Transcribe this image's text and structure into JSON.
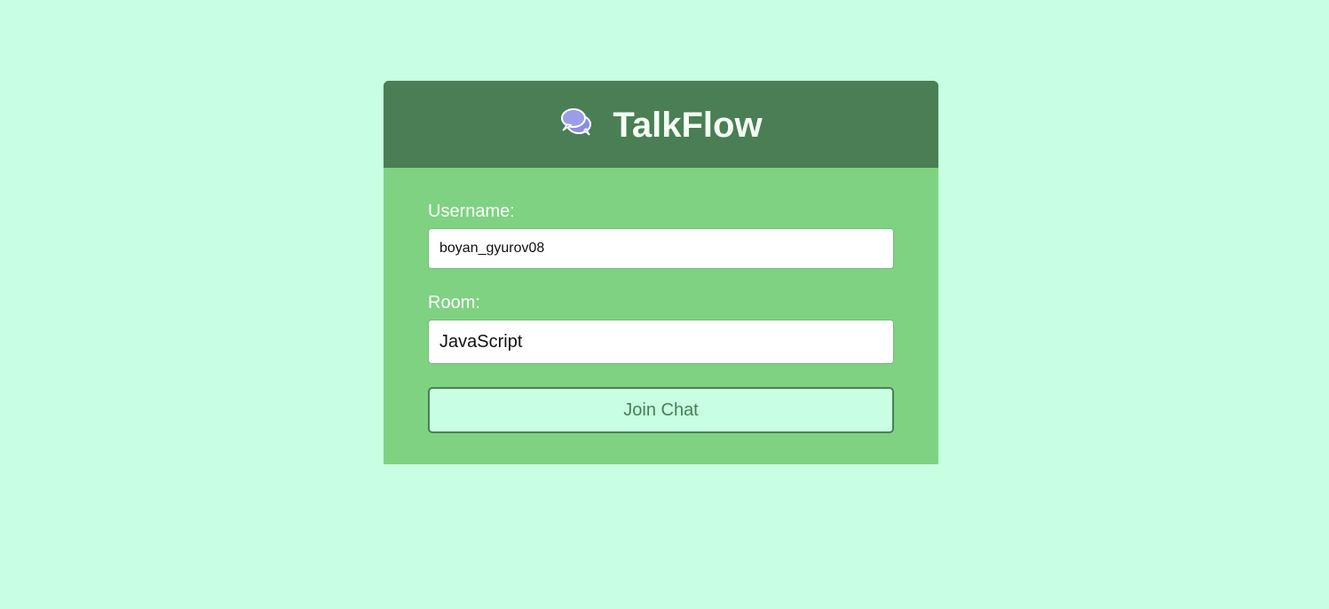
{
  "app": {
    "title": "TalkFlow",
    "logo_icon": "speech-bubbles-icon"
  },
  "form": {
    "username_label": "Username:",
    "username_value": "boyan_gyurov08",
    "room_label": "Room:",
    "room_value": "JavaScript",
    "join_label": "Join Chat"
  },
  "colors": {
    "page_background": "#c8ffe2",
    "card_background": "#7fd282",
    "header_background": "#4a7e55",
    "button_background": "#c8ffe2",
    "button_text": "#4a7e55"
  }
}
